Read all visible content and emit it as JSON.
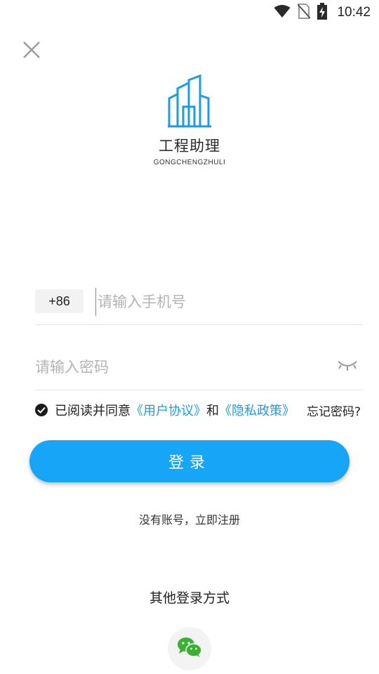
{
  "status_bar": {
    "time": "10:42",
    "icons": [
      "wifi-icon",
      "no-sim-icon",
      "battery-charging-icon"
    ]
  },
  "header": {
    "close_icon": "close-icon"
  },
  "logo": {
    "icon": "building-icon",
    "app_name": "工程助理",
    "app_name_pinyin": "GONGCHENGZHULI"
  },
  "form": {
    "country_code": "+86",
    "phone_placeholder": "请输入手机号",
    "password_placeholder": "请输入密码",
    "password_toggle_icon": "eye-closed-icon"
  },
  "agreement": {
    "checked": true,
    "prefix": "已阅读并同意",
    "user_agreement": "《用户协议》",
    "and": "和",
    "privacy_policy": "《隐私政策》",
    "forgot_password": "忘记密码?"
  },
  "login_button": "登录",
  "register_link": "没有账号，立即注册",
  "other_login": {
    "title": "其他登录方式",
    "wechat_icon": "wechat-icon"
  },
  "colors": {
    "accent": "#17a5f8",
    "link": "#1e9be6",
    "wechat": "#3cb034"
  }
}
